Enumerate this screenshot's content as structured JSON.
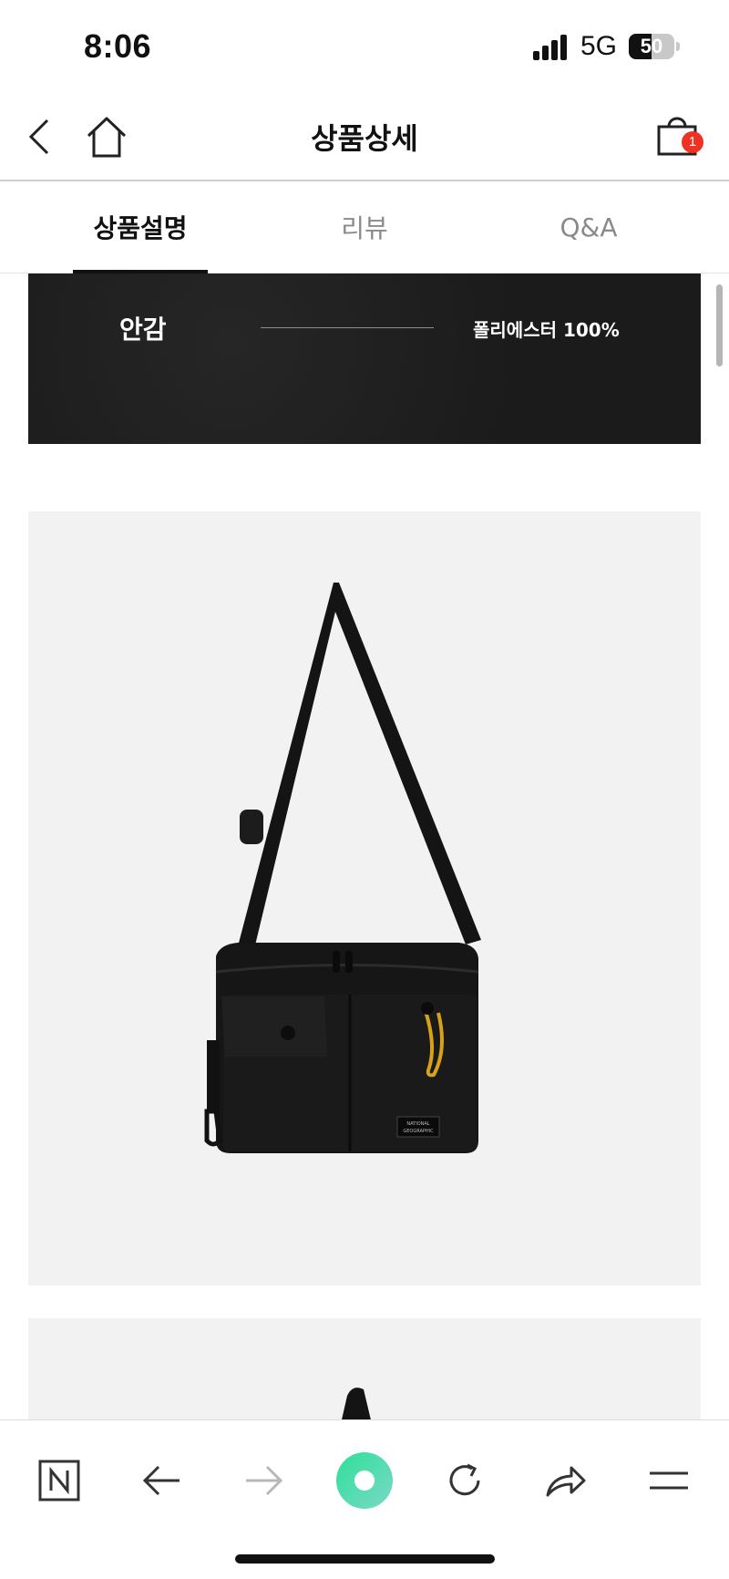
{
  "status_bar": {
    "time": "8:06",
    "network": "5G",
    "battery_level": "50"
  },
  "header": {
    "title": "상품상세",
    "cart_count": "1"
  },
  "tabs": [
    {
      "label": "상품설명",
      "active": true
    },
    {
      "label": "리뷰",
      "active": false
    },
    {
      "label": "Q&A",
      "active": false
    }
  ],
  "material_banner": {
    "label": "안감",
    "value": "폴리에스터 100%"
  },
  "product_image": {
    "badge_lines": [
      "NATIONAL",
      "GEOGRAPHIC"
    ]
  },
  "browser_bar": {
    "icons": [
      "naver-icon",
      "back-arrow-icon",
      "forward-arrow-icon",
      "green-dot-icon",
      "reload-icon",
      "share-icon",
      "menu-icon"
    ]
  },
  "colors": {
    "accent": "#ee3322",
    "green": "#3ccf8e",
    "banner_bg": "#1d1d1d"
  }
}
